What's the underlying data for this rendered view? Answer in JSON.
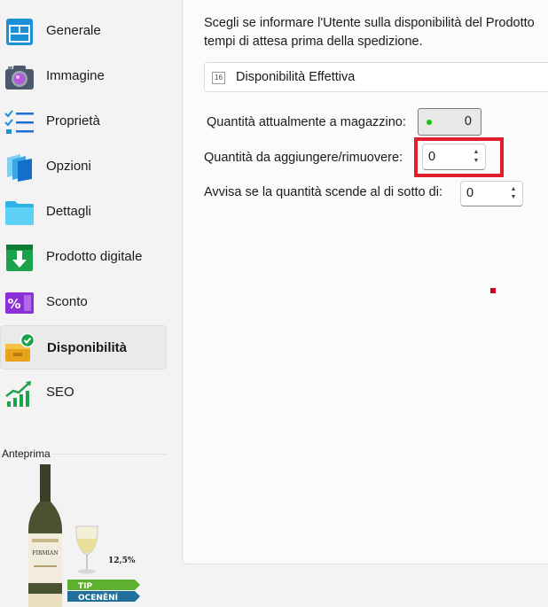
{
  "sidebar": {
    "items": [
      {
        "label": "Generale",
        "icon": "window-layout-icon"
      },
      {
        "label": "Immagine",
        "icon": "camera-icon"
      },
      {
        "label": "Proprietà",
        "icon": "checklist-icon"
      },
      {
        "label": "Opzioni",
        "icon": "stacked-cards-icon"
      },
      {
        "label": "Dettagli",
        "icon": "folder-icon"
      },
      {
        "label": "Prodotto digitale",
        "icon": "download-icon"
      },
      {
        "label": "Sconto",
        "icon": "percent-icon"
      },
      {
        "label": "Disponibilità",
        "icon": "box-check-icon",
        "active": true
      },
      {
        "label": "SEO",
        "icon": "trend-chart-icon"
      }
    ],
    "preview_label": "Anteprima",
    "preview": {
      "bottle_label": "FIRMIAN",
      "glass_text": "12,5%",
      "badge_top": "TIP",
      "badge_bottom": "OCENĚNÍ"
    }
  },
  "main": {
    "description_line1": "Scegli se informare l'Utente sulla disponibilità del Prodotto",
    "description_line2": "tempi di attesa prima della spedizione.",
    "combo": {
      "icon_text": "16",
      "value": "Disponibilità Effettiva"
    },
    "stock": {
      "label": "Quantità attualmente a magazzino:",
      "value": "0"
    },
    "adjust": {
      "label": "Quantità da aggiungere/rimuovere:",
      "value": "0"
    },
    "threshold": {
      "label": "Avvisa se la quantità scende al di sotto di:",
      "value": "0"
    }
  },
  "colors": {
    "highlight": "#e11d2e",
    "status_dot": "#16c60c",
    "active_background": "#eaeaea"
  }
}
